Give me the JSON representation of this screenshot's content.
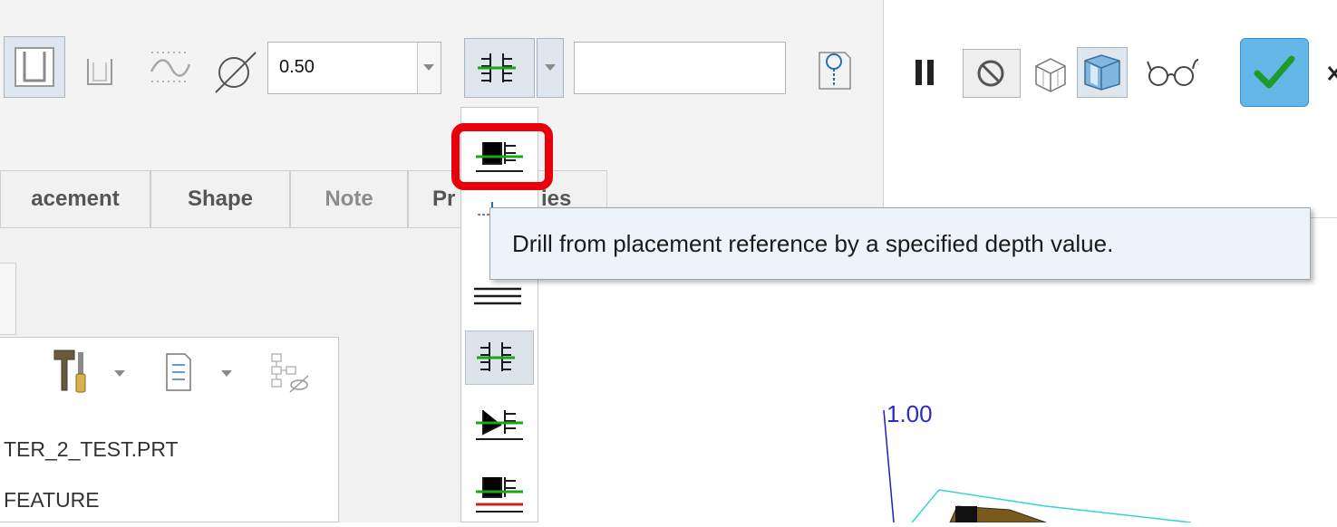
{
  "toolbar": {
    "diameter_value": "0.50",
    "depth_value": ""
  },
  "tabs": [
    {
      "label": "acement"
    },
    {
      "label": "Shape"
    },
    {
      "label": "Note"
    },
    {
      "label": "Pr"
    },
    {
      "label": "ies"
    }
  ],
  "tooltip": {
    "text": "Drill from placement reference by a specified depth value."
  },
  "model_tree": {
    "items": [
      {
        "label": "TER_2_TEST.PRT"
      },
      {
        "label": "FEATURE"
      }
    ]
  },
  "graphics": {
    "dimension_label": "1.00"
  },
  "colors": {
    "highlight": "#e8000c",
    "ok_button": "#5ab4e6",
    "dimension": "#2b2bc8",
    "tooltip_bg": "#eef3fa"
  }
}
